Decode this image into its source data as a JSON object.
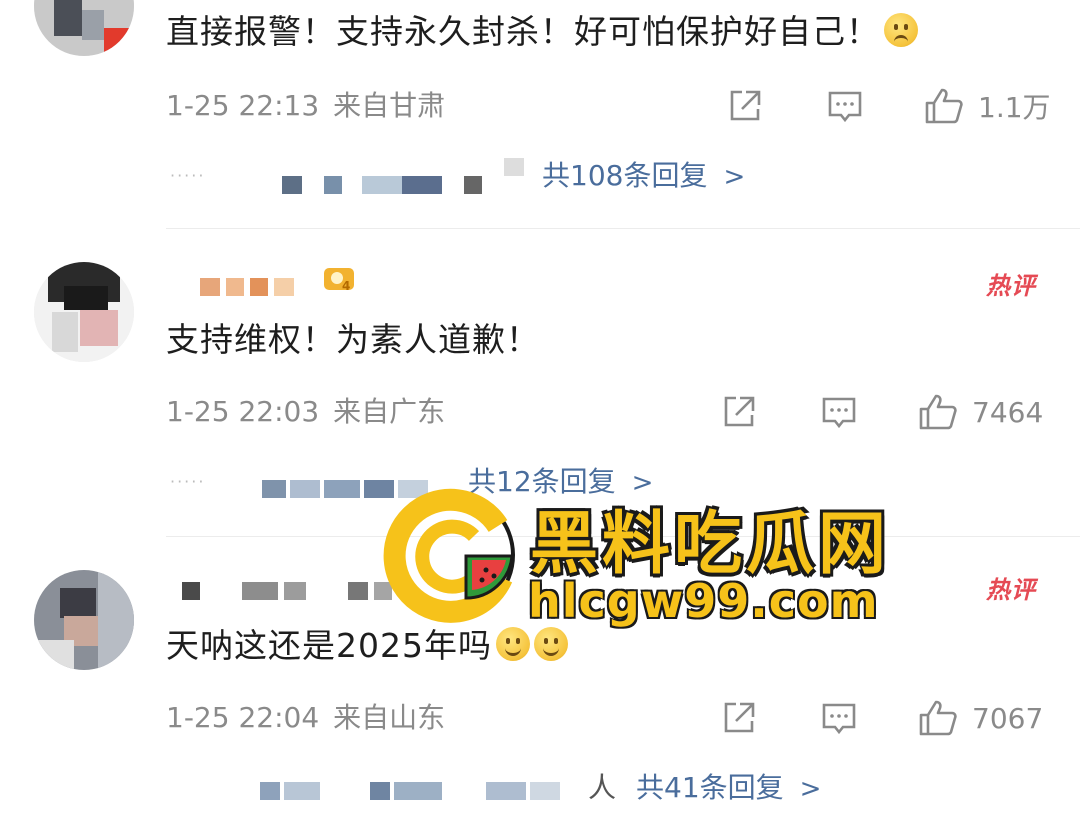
{
  "comments": [
    {
      "text": "直接报警！支持永久封杀！好可怕保护好自己！",
      "emoji": "sad-face",
      "date": "1-25 22:13",
      "location": "来自甘肃",
      "likes": "1.1万",
      "reply_link": "共108条回复",
      "hot": false
    },
    {
      "text": "支持维权！为素人道歉！",
      "date": "1-25 22:03",
      "location": "来自广东",
      "likes": "7464",
      "reply_link": "共12条回复",
      "hot": true,
      "hot_label": "热评"
    },
    {
      "text": "天呐这还是2025年吗",
      "emoji": "smile-face",
      "date": "1-25 22:04",
      "location": "来自山东",
      "likes": "7067",
      "reply_link": "共41条回复",
      "reply_prefix": "人",
      "hot": true,
      "hot_label": "热评"
    }
  ],
  "icons": {
    "share": "share-icon",
    "comment": "comment-icon",
    "like": "thumbs-up-icon",
    "chevron": "chevron-right-icon"
  },
  "chevron_glyph": ">",
  "watermark": {
    "title": "黑料吃瓜网",
    "url": "hlcgw99.com",
    "color": "#f6c21a"
  }
}
